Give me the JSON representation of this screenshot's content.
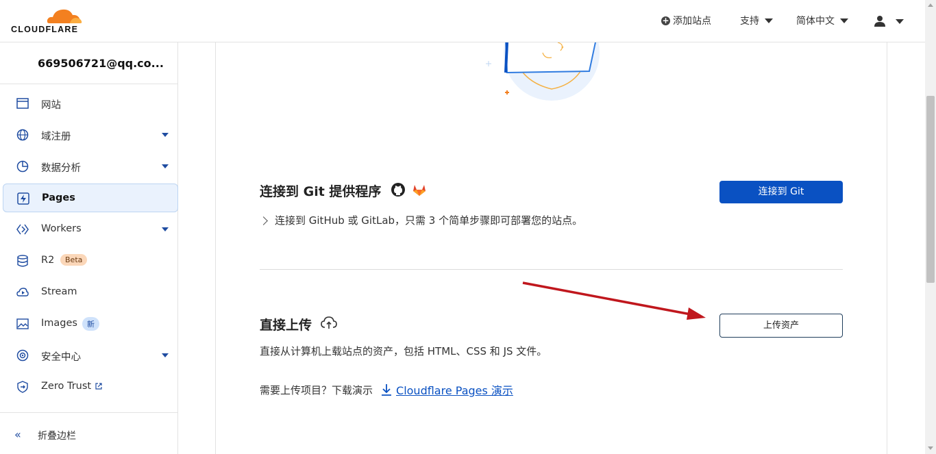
{
  "header": {
    "logo_text": "CLOUDFLARE",
    "add_site_label": "添加站点",
    "support_label": "支持",
    "language_label": "简体中文"
  },
  "sidebar": {
    "account": "669506721@qq.co...",
    "items": [
      {
        "label": "网站",
        "icon": "browser-window-icon"
      },
      {
        "label": "域注册",
        "icon": "globe-icon"
      },
      {
        "label": "数据分析",
        "icon": "pie-chart-icon"
      },
      {
        "label": "Pages",
        "icon": "lightning-icon"
      },
      {
        "label": "Workers",
        "icon": "workers-icon"
      },
      {
        "label": "R2",
        "icon": "database-icon",
        "badge": "Beta"
      },
      {
        "label": "Stream",
        "icon": "cloud-play-icon"
      },
      {
        "label": "Images",
        "icon": "image-icon",
        "badge": "新"
      },
      {
        "label": "安全中心",
        "icon": "security-center-icon"
      },
      {
        "label": "Zero Trust",
        "icon": "zero-trust-icon"
      }
    ],
    "collapse_label": "折叠边栏"
  },
  "main": {
    "git": {
      "title": "连接到 Git 提供程序",
      "description": "连接到 GitHub 或 GitLab，只需 3 个简单步骤即可部署您的站点。",
      "button": "连接到 Git"
    },
    "upload": {
      "title": "直接上传",
      "description": "直接从计算机上载站点的资产，包括 HTML、CSS 和 JS 文件。",
      "button": "上传资产",
      "demo_prefix": "需要上传项目？下载演示",
      "demo_link": "Cloudflare Pages 演示"
    }
  },
  "colors": {
    "primary": "#0a51c2",
    "accent_orange": "#f38020",
    "arrow_red": "#c0171d"
  }
}
